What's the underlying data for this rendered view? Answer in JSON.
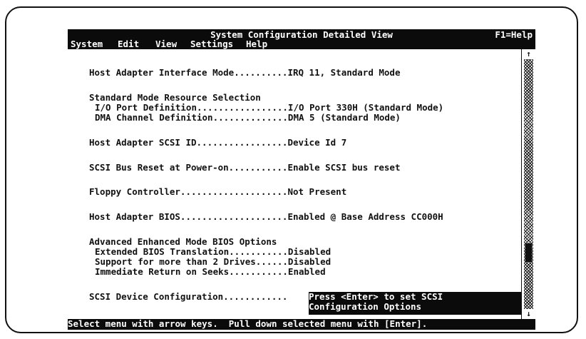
{
  "window": {
    "title": "System Configuration Detailed View",
    "help_hint": "F1=Help"
  },
  "menu": [
    {
      "label": "System"
    },
    {
      "label": "Edit"
    },
    {
      "label": "View"
    },
    {
      "label": "Settings"
    },
    {
      "label": "Help"
    }
  ],
  "lines": {
    "host_adapter_interface_mode": "Host Adapter Interface Mode..........IRQ 11, Standard Mode",
    "standard_mode_heading": "Standard Mode Resource Selection",
    "io_port_definition": "I/O Port Definition.................I/O Port 330H (Standard Mode)",
    "dma_channel_definition": "DMA Channel Definition..............DMA 5 (Standard Mode)",
    "host_adapter_scsi_id": "Host Adapter SCSI ID.................Device Id 7",
    "scsi_bus_reset": "SCSI Bus Reset at Power-on...........Enable SCSI bus reset",
    "floppy_controller": "Floppy Controller....................Not Present",
    "host_adapter_bios": "Host Adapter BIOS....................Enabled @ Base Address CC000H",
    "advanced_heading": "Advanced Enhanced Mode BIOS Options",
    "extended_bios_translation": "Extended BIOS Translation...........Disabled",
    "support_more_drives": "Support for more than 2 Drives......Disabled",
    "immediate_return": "Immediate Return on Seeks...........Enabled",
    "scsi_device_configuration": "SCSI Device Configuration............"
  },
  "selected_value": {
    "line1": "Press <Enter> to set SCSI",
    "line2": "Configuration Options"
  },
  "scrollbar": {
    "up_arrow": "↑",
    "down_arrow": "↓"
  },
  "status": "Select menu with arrow keys.  Pull down selected menu with [Enter]."
}
